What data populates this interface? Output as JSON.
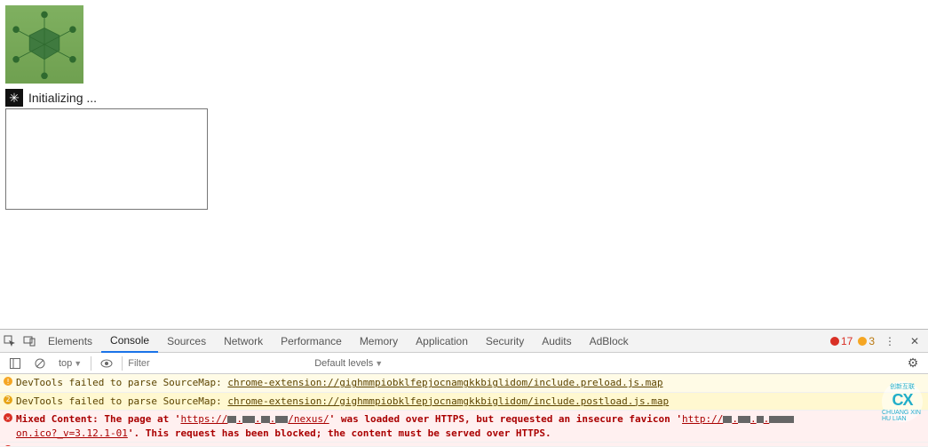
{
  "page": {
    "init_text": "Initializing ..."
  },
  "devtools": {
    "tabs": [
      "Elements",
      "Console",
      "Sources",
      "Network",
      "Performance",
      "Memory",
      "Application",
      "Security",
      "Audits",
      "AdBlock"
    ],
    "active_tab": "Console",
    "error_count": "17",
    "warn_count": "3",
    "filter": {
      "context": "top",
      "filter_placeholder": "Filter",
      "levels": "Default levels"
    },
    "console": {
      "line1_prefix": "DevTools failed to parse SourceMap: ",
      "line1_link": "chrome-extension://gighmmpiobklfepjocnamgkkbiglidom/include.preload.js.map",
      "line2_prefix": "DevTools failed to parse SourceMap: ",
      "line2_link": "chrome-extension://gighmmpiobklfepjocnamgkkbiglidom/include.postload.js.map",
      "line3_a": "Mixed Content: The page at '",
      "line3_b": "https://",
      "line3_c": "/nexus/",
      "line3_d": "' was loaded over HTTPS, but requested an insecure favicon '",
      "line3_e": "http://",
      "line3_f": "on.ico?_v=3.12.1-01",
      "line3_g": "'. This request has been blocked; the content must be served over HTTPS."
    }
  },
  "watermark": {
    "top": "创新互联",
    "mid": "CX",
    "bottom": "CHUANG XIN HU LIAN"
  }
}
